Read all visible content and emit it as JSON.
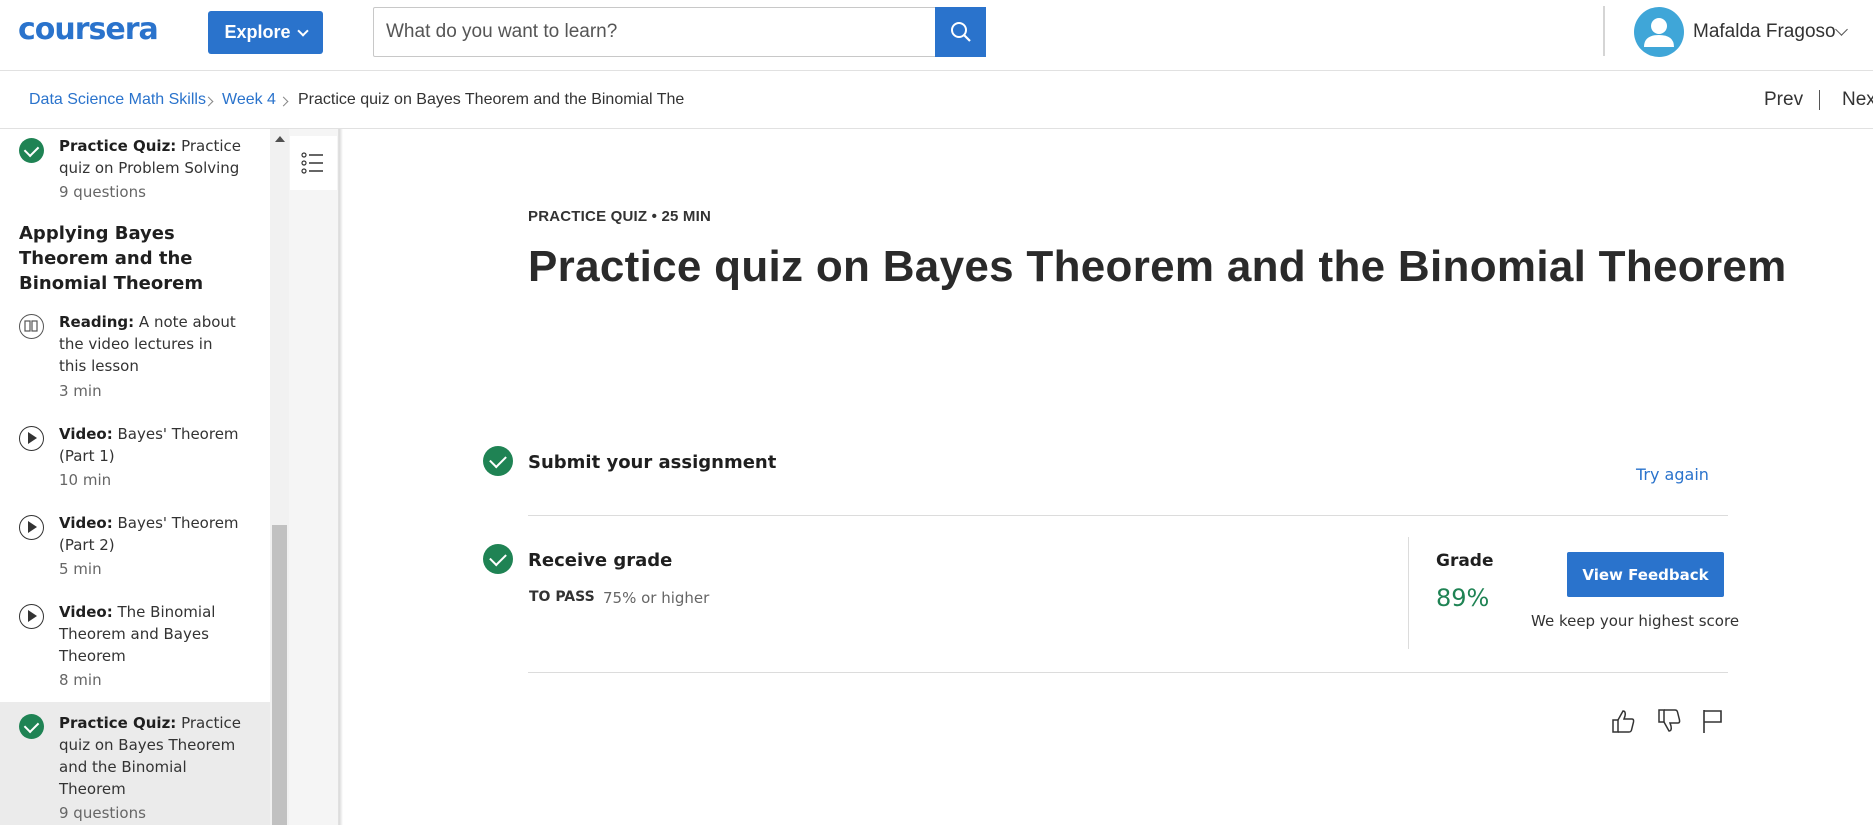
{
  "header": {
    "logo": "coursera",
    "explore_label": "Explore",
    "search_placeholder": "What do you want to learn?",
    "user_name": "Mafalda Fragoso"
  },
  "breadcrumb": {
    "items": [
      "Data Science Math Skills",
      "Week 4",
      "Practice quiz on Bayes Theorem and the Binomial The"
    ],
    "prev": "Prev",
    "next": "Nex"
  },
  "sidebar": {
    "items": [
      {
        "type_label": "Practice Quiz:",
        "title": "Practice quiz on Problem Solving",
        "meta": "9 questions",
        "status": "done",
        "icon": "check-icon"
      },
      {
        "type_label": "Reading:",
        "title": "A note about the video lectures in this lesson",
        "meta": "3 min",
        "status": "todo",
        "icon": "book-icon"
      },
      {
        "type_label": "Video:",
        "title": "Bayes' Theorem (Part 1)",
        "meta": "10 min",
        "status": "todo",
        "icon": "play-icon"
      },
      {
        "type_label": "Video:",
        "title": "Bayes' Theorem (Part 2)",
        "meta": "5 min",
        "status": "todo",
        "icon": "play-icon"
      },
      {
        "type_label": "Video:",
        "title": "The Binomial Theorem and Bayes Theorem",
        "meta": "8 min",
        "status": "todo",
        "icon": "play-icon"
      },
      {
        "type_label": "Practice Quiz:",
        "title": "Practice quiz on Bayes Theorem and the Binomial Theorem",
        "meta": "9 questions",
        "status": "done",
        "icon": "check-icon",
        "active": true
      }
    ],
    "section_title": "Applying Bayes Theorem and the Binomial Theorem"
  },
  "main": {
    "eyebrow": "PRACTICE QUIZ • 25 MIN",
    "title": "Practice quiz on Bayes Theorem and the Binomial Theorem",
    "submit": {
      "title": "Submit your assignment",
      "action": "Try again"
    },
    "receive": {
      "title": "Receive grade",
      "to_pass_label": "TO PASS",
      "to_pass_value": "75% or higher",
      "grade_label": "Grade",
      "grade_value": "89%",
      "feedback_button": "View Feedback",
      "note": "We keep your highest score"
    }
  },
  "colors": {
    "accent": "#2a73cc",
    "success": "#1f8354"
  }
}
